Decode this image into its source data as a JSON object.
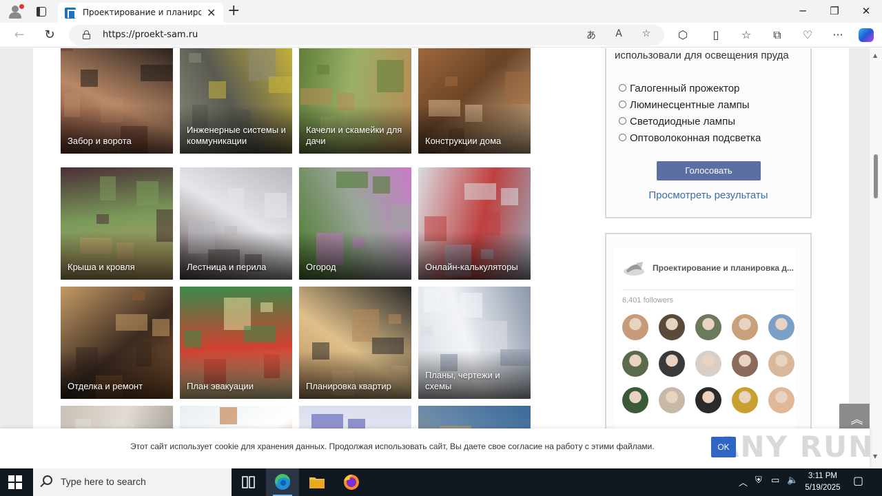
{
  "browser": {
    "tab_title": "Проектирование и планировка",
    "url": "https://proekt-sam.ru"
  },
  "tiles": [
    {
      "label": "Забор и ворота",
      "palette": [
        "#6b3a2c",
        "#1f1a18",
        "#b98866"
      ]
    },
    {
      "label": "Инженерные системы и коммуникации",
      "palette": [
        "#8a8a7a",
        "#c9b43a",
        "#5a5a52"
      ]
    },
    {
      "label": "Качели и скамейки для дачи",
      "palette": [
        "#5e7d3a",
        "#b88a55",
        "#9ab066"
      ]
    },
    {
      "label": "Конструкции дома",
      "palette": [
        "#a06a3e",
        "#d9b890",
        "#6b4426"
      ]
    },
    {
      "label": "Крыша и кровля",
      "palette": [
        "#4a2f36",
        "#c7a46a",
        "#7a9a5a"
      ]
    },
    {
      "label": "Лестница и перила",
      "palette": [
        "#b8b8c0",
        "#5a4a48",
        "#e5e5ea"
      ]
    },
    {
      "label": "Огород",
      "palette": [
        "#c77cc9",
        "#4a7a2a",
        "#9aa59a"
      ]
    },
    {
      "label": "Онлайн-калькуляторы",
      "palette": [
        "#9aa8b8",
        "#d8dce0",
        "#c04040"
      ]
    },
    {
      "label": "Отделка и ремонт",
      "palette": [
        "#8a5a30",
        "#c49a66",
        "#3a2a20"
      ]
    },
    {
      "label": "План эвакуации",
      "palette": [
        "#e8dfa0",
        "#3a8a4a",
        "#d04030"
      ]
    },
    {
      "label": "Планировка квартир",
      "palette": [
        "#b5895a",
        "#2a2a2a",
        "#e0c08a"
      ]
    },
    {
      "label": "Планы, чертежи и схемы",
      "palette": [
        "#d8dde4",
        "#8a96a8",
        "#f2f4f7"
      ]
    },
    {
      "label": "",
      "palette": [
        "#c8bfb5",
        "#8e867d",
        "#e2dcd4"
      ]
    },
    {
      "label": "",
      "palette": [
        "#e8eef2",
        "#b86a2a",
        "#ffffff"
      ]
    },
    {
      "label": "",
      "palette": [
        "#d8dcec",
        "#4a4ab0",
        "#eef0f8"
      ]
    },
    {
      "label": "",
      "palette": [
        "#3a6a9a",
        "#c89a5a",
        "#6a8aaa"
      ]
    }
  ],
  "poll": {
    "question": "использовали для освещения пруда",
    "options": [
      "Галогенный прожектор",
      "Люминесцентные лампы",
      "Светодиодные лампы",
      "Оптоволоконная подсветка"
    ],
    "vote_label": "Голосовать",
    "results_label": "Просмотреть результаты"
  },
  "vk": {
    "group_name": "Проектирование и планировка д...",
    "followers": "6,401 followers",
    "avatar_colors": [
      "#c79a7a",
      "#5a4a3a",
      "#6a7a5a",
      "#c8a07a",
      "#7aa0c8",
      "#5a6a4a",
      "#3a3a3a",
      "#d8d0c8",
      "#8a6a5a",
      "#d8b89a",
      "#3a5a3a",
      "#c8b8a8",
      "#2a2a2a",
      "#c8a030",
      "#e0b898"
    ]
  },
  "cookie": {
    "text": "Этот сайт использует cookie для хранения данных. Продолжая использовать сайт, Вы даете свое согласие на работу с этими файлами.",
    "ok_label": "OK",
    "watermark": "ANY RUN"
  },
  "taskbar": {
    "search_placeholder": "Type here to search",
    "time": "3:11 PM",
    "date": "5/19/2025"
  }
}
